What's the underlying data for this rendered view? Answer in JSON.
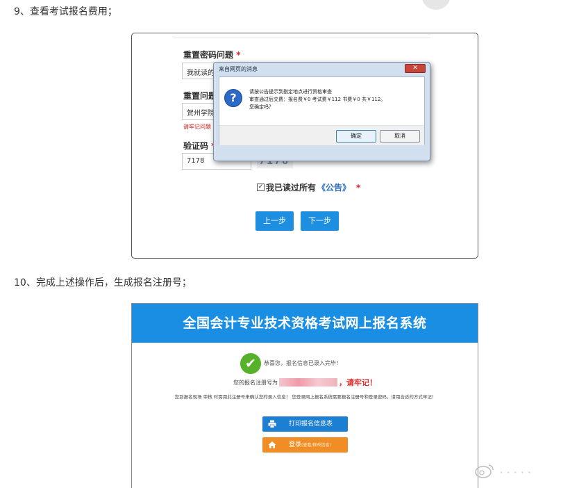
{
  "steps": [
    {
      "heading": "9、查看考试报名费用；"
    },
    {
      "heading": "10、完成上述操作后，生成报名注册号；"
    }
  ],
  "shot1": {
    "reset_question_label": "重置密码问题",
    "reset_question_value": "我就读的",
    "reset_answer_label": "重置问题",
    "reset_answer_value": "贺州学院",
    "warning_text": "请牢记问题",
    "captcha_label": "验证码",
    "required_mark": "*",
    "captcha_value": "7178",
    "captcha_image_text": "7178",
    "agree_checkmark": "✓",
    "agree_text": "我已读过所有",
    "agree_link": "《公告》",
    "prev_button": "上一步",
    "next_button": "下一步",
    "dialog": {
      "title": "来自网页的消息",
      "close_glyph": "✕",
      "question_glyph": "?",
      "line1": "请按公告提示到指定地点进行资格审查",
      "line2": "审查通过后交费：报名费￥0 考试费￥112 书费￥0 共￥112。",
      "line3": "您确定吗？",
      "ok_button": "确定",
      "cancel_button": "取消"
    }
  },
  "shot2": {
    "banner_title": "全国会计专业技术资格考试网上报名系统",
    "check_glyph": "✔",
    "success_message": "恭喜您，报名信息已录入完毕！",
    "regno_prefix": "您的报名注册号为",
    "regno_suffix": "，请牢记！",
    "hint": "您到报名现场 审核 时需用此注册号来确认您的录入信息！ 您登录网上报名系统需要报名注册号和登录密码，请用合适的方式牢记！",
    "print_button": "打印报名信息表",
    "print_icon": "printer-icon",
    "login_button": "登录",
    "login_sub": "(查看/修改信息)",
    "login_icon": "home-icon"
  },
  "colors": {
    "banner_blue": "#1a8ee2",
    "button_blue": "#1d8ee0",
    "login_orange": "#f08d24",
    "success_green": "#55b22a",
    "alert_red": "#e02a2a"
  }
}
